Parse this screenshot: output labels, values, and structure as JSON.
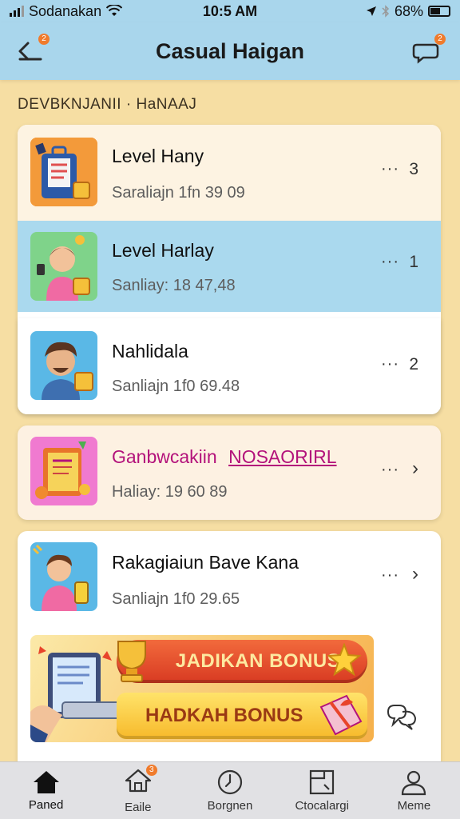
{
  "status_bar": {
    "carrier": "Sodanakan",
    "time": "10:5 AM",
    "battery": "68%"
  },
  "header": {
    "title": "Casual Haigan",
    "back_badge": "2",
    "chat_badge": "2",
    "back_icon": "back-arrow-icon",
    "chat_icon": "chat-bubble-icon"
  },
  "section_label": "DEVBKNJANII · HaNAAJ",
  "list": [
    {
      "title": "Level Hany",
      "subtitle": "Saraliajn 1fn 39 09",
      "count": "3",
      "more": "···",
      "bg": "#fdf3e2"
    },
    {
      "title": "Level Harlay",
      "subtitle": "Sanliay: 18 47,48",
      "count": "1",
      "more": "···",
      "bg": "#aad9ee"
    },
    {
      "title": "Nahlidala",
      "subtitle": "Sanliajn 1f0 69.48",
      "count": "2",
      "more": "···",
      "bg": "#ffffff"
    },
    {
      "title": "Ganbwcakiin",
      "title_highlight": "NOSAORIRL",
      "subtitle": "Haliay: 19 60 89",
      "more": "···",
      "bg": "#fdf1e2"
    },
    {
      "title": "Rakagiaiun Bave Kana",
      "subtitle": "Sanliajn 1f0 29.65",
      "more": "···",
      "bg": "#ffffff"
    }
  ],
  "bonus": {
    "primary_label": "JADIKAN BONUS",
    "secondary_label": "HADKAH BONUS",
    "chat_icon": "chat-bubbles-icon"
  },
  "nav": [
    {
      "label": "Paned",
      "icon": "home-icon",
      "active": true
    },
    {
      "label": "Eaile",
      "icon": "house-outline-icon",
      "badge": "3"
    },
    {
      "label": "Borgnen",
      "icon": "clock-icon"
    },
    {
      "label": "Ctocalargi",
      "icon": "calendar-box-icon"
    },
    {
      "label": "Meme",
      "icon": "profile-icon"
    }
  ],
  "colors": {
    "background": "#f6dea3",
    "header": "#a9d6ec",
    "highlight_row": "#aad9ee",
    "accent_purple": "#b3127b",
    "bonus_red": "#e8442a",
    "bonus_yellow": "#ffd13b"
  }
}
